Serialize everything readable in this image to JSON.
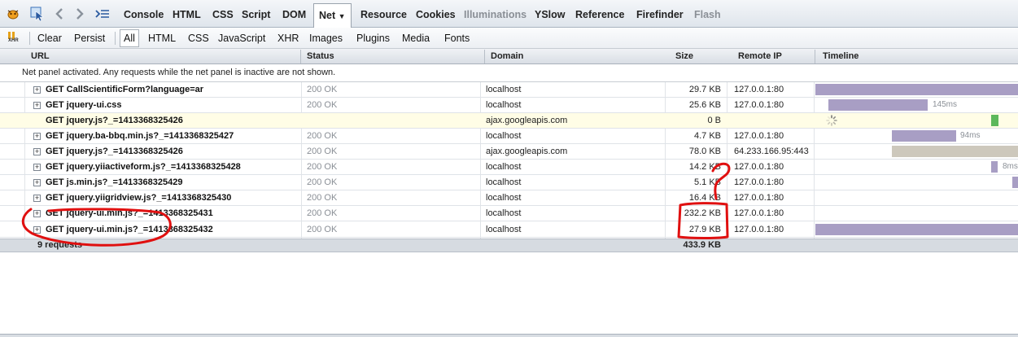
{
  "tabs": [
    "Console",
    "HTML",
    "CSS",
    "Script",
    "DOM",
    "Net",
    "Resource",
    "Cookies",
    "Illuminations",
    "YSlow",
    "Reference",
    "Firefinder",
    "Flash"
  ],
  "active_tab": "Net",
  "filters": {
    "clear": "Clear",
    "persist": "Persist",
    "types": [
      "All",
      "HTML",
      "CSS",
      "JavaScript",
      "XHR",
      "Images",
      "Plugins",
      "Media",
      "Fonts"
    ],
    "active": "All"
  },
  "xhr_icon_text": "XHR",
  "columns": {
    "url": "URL",
    "status": "Status",
    "domain": "Domain",
    "size": "Size",
    "remote_ip": "Remote IP",
    "timeline": "Timeline"
  },
  "info_message": "Net panel activated. Any requests while the net panel is inactive are not shown.",
  "requests": [
    {
      "url": "GET CallScientificForm?language=ar",
      "status": "200 OK",
      "domain": "localhost",
      "size": "29.7 KB",
      "ip": "127.0.0.1:80",
      "timeline_label": ""
    },
    {
      "url": "GET jquery-ui.css",
      "status": "200 OK",
      "domain": "localhost",
      "size": "25.6 KB",
      "ip": "127.0.0.1:80",
      "timeline_label": "145ms"
    },
    {
      "url": "GET jquery.js?_=1413368325426",
      "status": "",
      "domain": "ajax.googleapis.com",
      "size": "0 B",
      "ip": "",
      "timeline_label": ""
    },
    {
      "url": "GET jquery.ba-bbq.min.js?_=1413368325427",
      "status": "200 OK",
      "domain": "localhost",
      "size": "4.7 KB",
      "ip": "127.0.0.1:80",
      "timeline_label": "94ms"
    },
    {
      "url": "GET jquery.js?_=1413368325426",
      "status": "200 OK",
      "domain": "ajax.googleapis.com",
      "size": "78.0 KB",
      "ip": "64.233.166.95:443",
      "timeline_label": ""
    },
    {
      "url": "GET jquery.yiiactiveform.js?_=1413368325428",
      "status": "200 OK",
      "domain": "localhost",
      "size": "14.2 KB",
      "ip": "127.0.0.1:80",
      "timeline_label": "8ms"
    },
    {
      "url": "GET js.min.js?_=1413368325429",
      "status": "200 OK",
      "domain": "localhost",
      "size": "5.1 KB",
      "ip": "127.0.0.1:80",
      "timeline_label": ""
    },
    {
      "url": "GET jquery.yiigridview.js?_=1413368325430",
      "status": "200 OK",
      "domain": "localhost",
      "size": "16.4 KB",
      "ip": "127.0.0.1:80",
      "timeline_label": ""
    },
    {
      "url": "GET jquery-ui.min.js?_=1413368325431",
      "status": "200 OK",
      "domain": "localhost",
      "size": "232.2 KB",
      "ip": "127.0.0.1:80",
      "timeline_label": ""
    },
    {
      "url": "GET jquery-ui.min.js?_=1413368325432",
      "status": "200 OK",
      "domain": "localhost",
      "size": "27.9 KB",
      "ip": "127.0.0.1:80",
      "timeline_label": ""
    }
  ],
  "summary": {
    "count": "9 requests",
    "total_size": "433.9 KB"
  },
  "colors": {
    "bar_received": "#a89ec4",
    "bar_waiting": "#cdc8bc",
    "bar_green": "#5cb85c",
    "annotation": "#e01010"
  }
}
